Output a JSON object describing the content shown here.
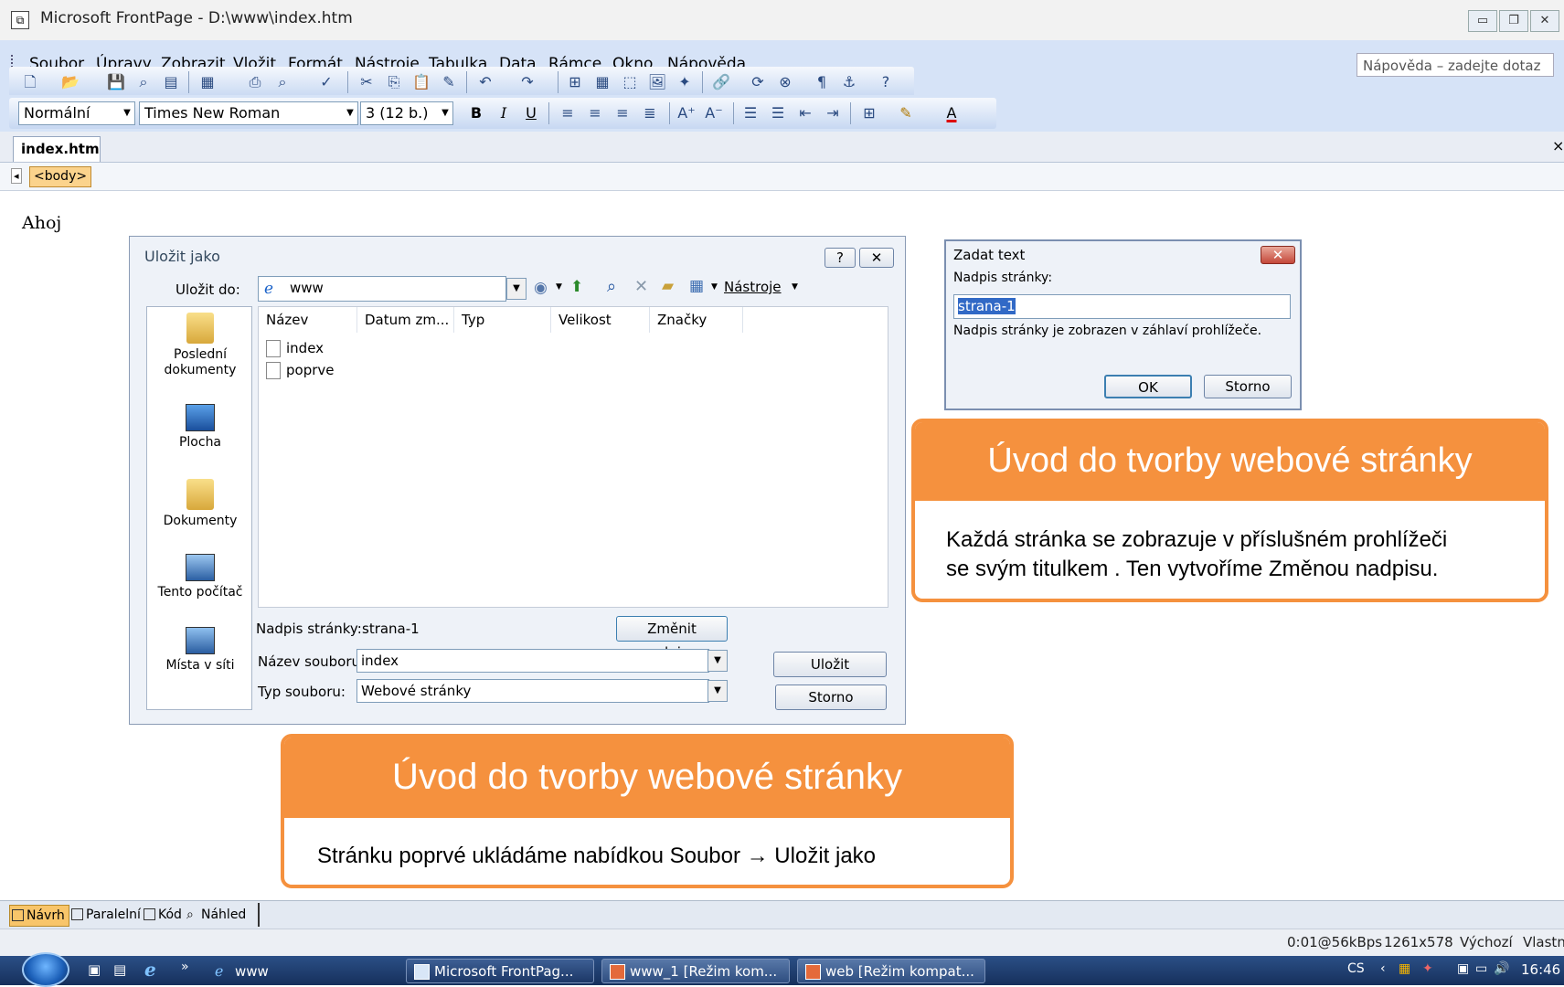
{
  "titlebar": {
    "title": "Microsoft FrontPage - D:\\www\\index.htm",
    "btn_min": "▭",
    "btn_restore": "❐",
    "btn_close": "✕"
  },
  "menubar": {
    "items": [
      "Soubor",
      "Úpravy",
      "Zobrazit",
      "Vložit",
      "Formát",
      "Nástroje",
      "Tabulka",
      "Data",
      "Rámce",
      "Okno",
      "Nápověda"
    ],
    "help_placeholder": "Nápověda – zadejte dotaz"
  },
  "formatting": {
    "style": "Normální",
    "font": "Times New Roman",
    "size": "3 (12 b.)",
    "bold": "B",
    "italic": "I",
    "underline": "U",
    "font_color": "A"
  },
  "tabs": {
    "active": "index.htm",
    "close": "×"
  },
  "tagbar": {
    "tag": "<body>"
  },
  "page": {
    "text": "Ahoj"
  },
  "save_dialog": {
    "title": "Uložit jako",
    "help_btn": "?",
    "close_btn": "✕",
    "save_in_label": "Uložit do:",
    "save_in_value": "www",
    "tools_label": "Nástroje",
    "places": [
      "Poslední dokumenty",
      "Plocha",
      "Dokumenty",
      "Tento počítač",
      "Místa v síti"
    ],
    "columns": [
      "Název",
      "Datum zm...",
      "Typ",
      "Velikost",
      "Značky"
    ],
    "files": [
      "index",
      "poprve"
    ],
    "page_title_label": "Nadpis stránky:",
    "page_title_value": "strana-1",
    "change_title_btn": "Změnit nadpis...",
    "filename_label": "Název souboru:",
    "filename_value": "index",
    "filetype_label": "Typ souboru:",
    "filetype_value": "Webové stránky",
    "save_btn": "Uložit",
    "cancel_btn": "Storno"
  },
  "enter_text_dialog": {
    "title": "Zadat text",
    "close_btn": "✕",
    "label": "Nadpis stránky:",
    "value": "strana-1",
    "hint": "Nadpis stránky je zobrazen v záhlaví prohlížeče.",
    "ok_btn": "OK",
    "cancel_btn": "Storno"
  },
  "callouts": [
    {
      "title": "Úvod do tvorby webové stránky",
      "text_line1": "Každá stránka se zobrazuje v příslušném prohlížeči",
      "text_line2": "se svým titulkem . Ten vytvoříme Změnou nadpisu."
    },
    {
      "title": "Úvod do tvorby webové stránky",
      "text": "Stránku poprvé ukládáme nabídkou Soubor → Uložit jako"
    }
  ],
  "view_tabs": [
    "Návrh",
    "Paralelní",
    "Kód",
    "Náhled"
  ],
  "status": {
    "speed": "0:01@56kBps",
    "resolution": "1261x578",
    "mode1": "Výchozí",
    "mode2": "Vlastní"
  },
  "taskbar": {
    "tasks": [
      "www",
      "Microsoft FrontPag...",
      "www_1 [Režim kom...",
      "web [Režim kompat..."
    ],
    "lang": "CS",
    "time": "16:46"
  },
  "colors": {
    "accent": "#f5913e",
    "toolbar": "#d6e3f7",
    "taskbar": "#1f3b6c"
  }
}
